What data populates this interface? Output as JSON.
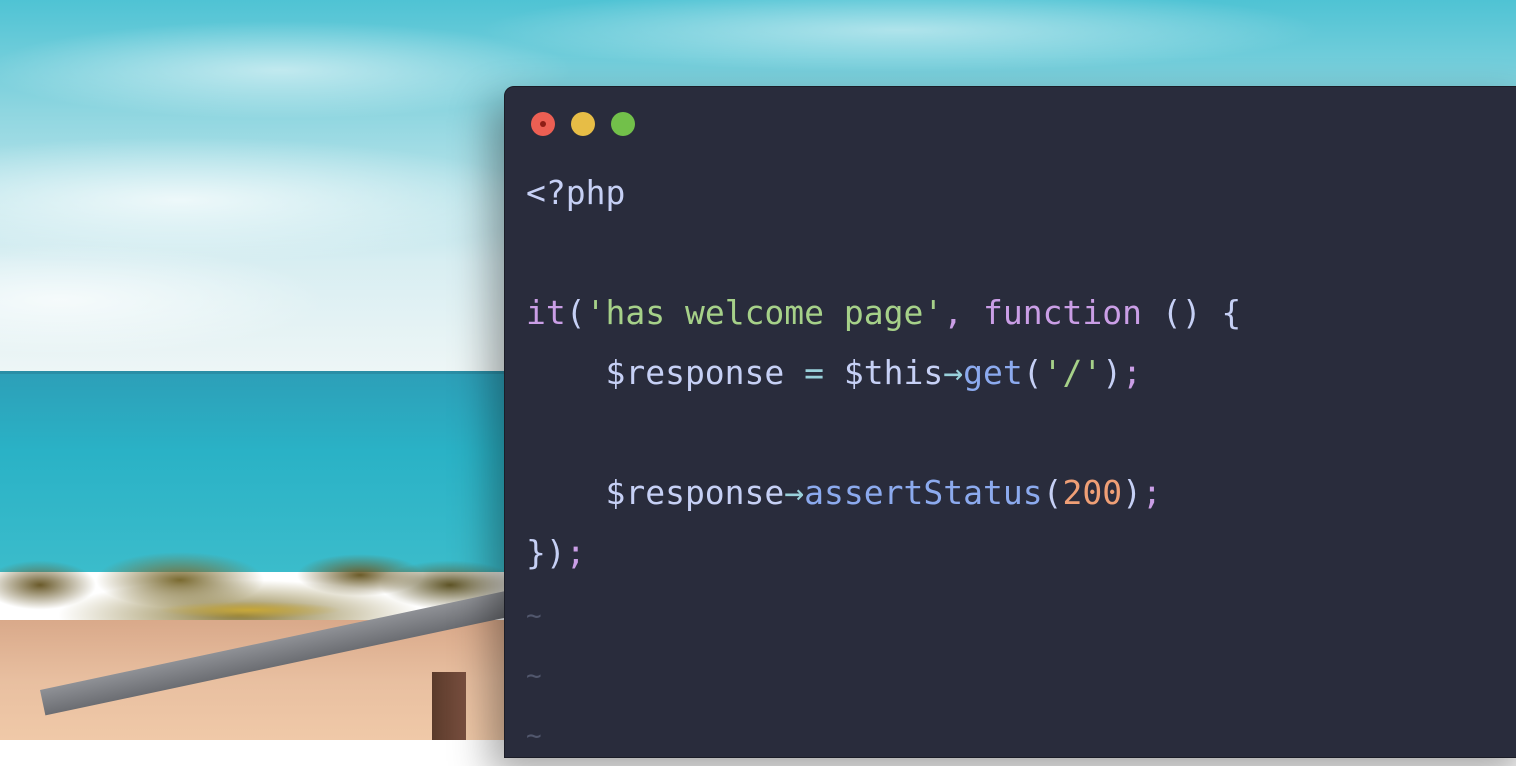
{
  "window": {
    "controls": [
      "close-icon",
      "minimize-icon",
      "zoom-icon"
    ],
    "colors": {
      "background": "#292c3c",
      "close": "#ec5f53",
      "minimize": "#e7bd46",
      "zoom": "#72c04a"
    }
  },
  "code": {
    "lines": [
      {
        "tokens": [
          {
            "t": "<?php",
            "k": "plain"
          }
        ]
      },
      {
        "tokens": []
      },
      {
        "tokens": [
          {
            "t": "it",
            "k": "kw"
          },
          {
            "t": "(",
            "k": "plain"
          },
          {
            "t": "'has welcome page'",
            "k": "str"
          },
          {
            "t": ", ",
            "k": "kw"
          },
          {
            "t": "function",
            "k": "kw"
          },
          {
            "t": " () {",
            "k": "plain"
          }
        ]
      },
      {
        "tokens": [
          {
            "t": "    $response",
            "k": "plain"
          },
          {
            "t": " = ",
            "k": "op"
          },
          {
            "t": "$this",
            "k": "plain"
          },
          {
            "t": "→",
            "k": "op"
          },
          {
            "t": "get",
            "k": "fn"
          },
          {
            "t": "(",
            "k": "plain"
          },
          {
            "t": "'/'",
            "k": "str"
          },
          {
            "t": ")",
            "k": "plain"
          },
          {
            "t": ";",
            "k": "kw"
          }
        ]
      },
      {
        "tokens": []
      },
      {
        "tokens": [
          {
            "t": "    $response",
            "k": "plain"
          },
          {
            "t": "→",
            "k": "op"
          },
          {
            "t": "assertStatus",
            "k": "fn"
          },
          {
            "t": "(",
            "k": "plain"
          },
          {
            "t": "200",
            "k": "num"
          },
          {
            "t": ")",
            "k": "plain"
          },
          {
            "t": ";",
            "k": "kw"
          }
        ]
      },
      {
        "tokens": [
          {
            "t": "})",
            "k": "plain"
          },
          {
            "t": ";",
            "k": "kw"
          }
        ]
      },
      {
        "tokens": [
          {
            "t": "~",
            "k": "tilde"
          }
        ]
      },
      {
        "tokens": [
          {
            "t": "~",
            "k": "tilde"
          }
        ]
      },
      {
        "tokens": [
          {
            "t": "~",
            "k": "tilde"
          }
        ]
      }
    ]
  },
  "syntax_colors": {
    "plain": "#c6d0f5",
    "kw": "#ca9ee6",
    "str": "#a6d189",
    "fn": "#8caaee",
    "op": "#99d1db",
    "num": "#ef9f76",
    "tilde": "#51576d"
  }
}
